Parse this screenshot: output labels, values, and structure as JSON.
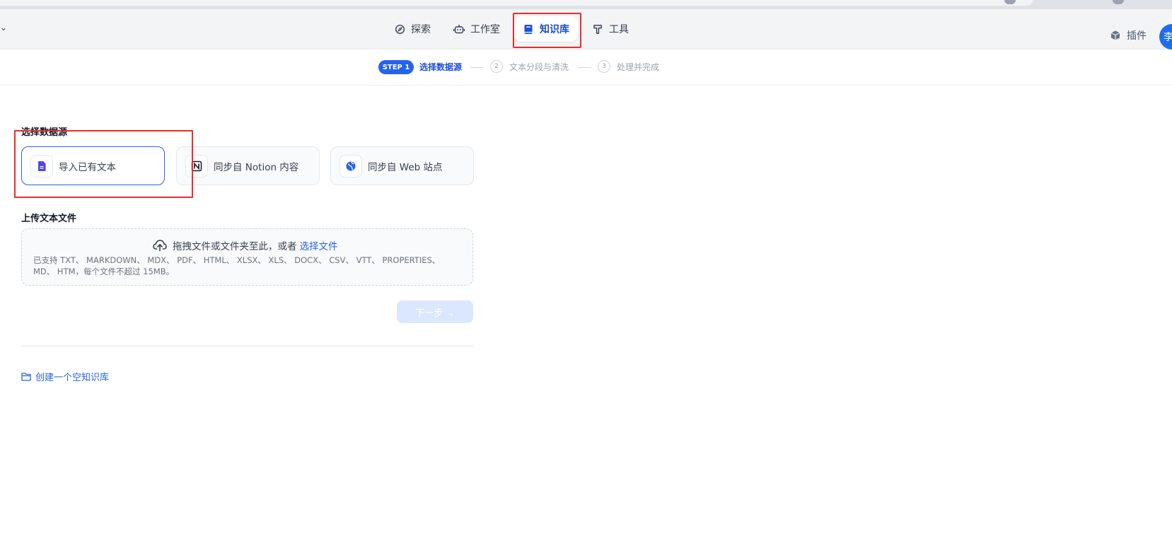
{
  "header": {
    "nav": [
      {
        "label": "探索",
        "icon": "compass-icon"
      },
      {
        "label": "工作室",
        "icon": "robot-icon"
      },
      {
        "label": "知识库",
        "icon": "book-icon",
        "active": true
      },
      {
        "label": "工具",
        "icon": "hammer-icon"
      }
    ],
    "plugin_label": "插件",
    "avatar_text": "李"
  },
  "steps": {
    "badge": "STEP 1",
    "step1_label": "选择数据源",
    "step2_num": "2",
    "step2_label": "文本分段与清洗",
    "step3_num": "3",
    "step3_label": "处理并完成"
  },
  "main": {
    "source_title": "选择数据源",
    "sources": [
      {
        "label": "导入已有文本",
        "icon": "file-text-icon",
        "selected": true
      },
      {
        "label": "同步自 Notion 内容",
        "icon": "notion-icon"
      },
      {
        "label": "同步自 Web 站点",
        "icon": "globe-icon"
      }
    ],
    "upload_title": "上传文本文件",
    "upload_main": "拖拽文件或文件夹至此，或者",
    "upload_link": "选择文件",
    "upload_hint": "已支持 TXT、 MARKDOWN、 MDX、 PDF、 HTML、 XLSX、 XLS、 DOCX、 CSV、 VTT、 PROPERTIES、 MD、 HTM，每个文件不超过 15MB。",
    "next_label": "下一步 →",
    "create_empty_label": "创建一个空知识库"
  },
  "colors": {
    "accent": "#2563eb",
    "highlight_box": "#ef2b2b"
  }
}
